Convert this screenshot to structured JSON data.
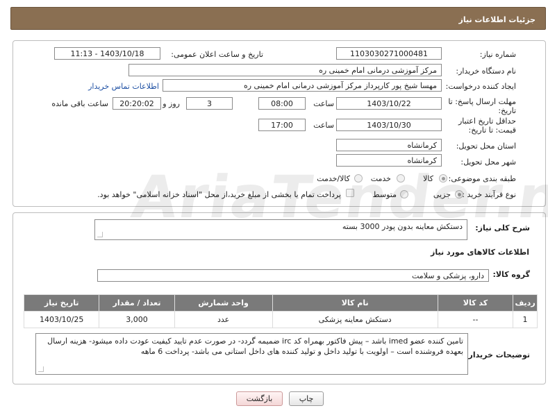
{
  "header": {
    "title": "جزئیات اطلاعات نیاز"
  },
  "form": {
    "need_number_label": "شماره نیاز:",
    "need_number": "1103030271000481",
    "announce_label": "تاریخ و ساعت اعلان عمومی:",
    "announce_value": "1403/10/18 - 11:13",
    "buyer_org_label": "نام دستگاه خریدار:",
    "buyer_org": "مرکز آموزشی درمانی امام خمینی ره",
    "creator_label": "ایجاد کننده درخواست:",
    "creator": "مهسا شیخ پور کارپرداز مرکز آموزشی درمانی امام خمینی ره",
    "contact_link": "اطلاعات تماس خریدار",
    "reply_deadline_label": "مهلت ارسال پاسخ: تا تاریخ:",
    "reply_date": "1403/10/22",
    "time_label": "ساعت",
    "reply_time": "08:00",
    "days": "3",
    "days_label": "روز و",
    "remaining_time": "20:20:02",
    "remaining_label": "ساعت باقی مانده",
    "price_validity_label": "حداقل تاریخ اعتبار قیمت: تا تاریخ:",
    "validity_date": "1403/10/30",
    "validity_time_label": "ساعت",
    "validity_time": "17:00",
    "province_label": "استان محل تحویل:",
    "province": "کرمانشاه",
    "city_label": "شهر محل تحویل:",
    "city": "کرمانشاه",
    "category_label": "طبقه بندی موضوعی:",
    "category_options": [
      "کالا",
      "خدمت",
      "کالا/خدمت"
    ],
    "category_selected": "کالا",
    "process_label": "نوع فرآیند خرید :",
    "process_options": [
      "جزیی",
      "متوسط"
    ],
    "process_selected": "جزیی",
    "payment_note": "پرداخت تمام یا بخشی از مبلغ خرید،از محل \"اسناد خزانه اسلامی\" خواهد بود."
  },
  "details": {
    "description_label": "شرح کلی نیاز:",
    "description": "دستکش معاینه بدون پودر 3000 بسته",
    "goods_info_title": "اطلاعات کالاهای مورد نیاز",
    "goods_group_label": "گروه کالا:",
    "goods_group": "دارو، پزشکی و سلامت",
    "table_headers": [
      "ردیف",
      "کد کالا",
      "نام کالا",
      "واحد شمارش",
      "تعداد / مقدار",
      "تاریخ نیاز"
    ],
    "table_rows": [
      [
        "1",
        "--",
        "دستکش معاینه پزشکی",
        "عدد",
        "3,000",
        "1403/10/25"
      ]
    ],
    "buyer_notes_label": "توضیحات خریدار:",
    "buyer_notes": "تامین کننده عضو imed باشد – پیش فاکتور بهمراه کد irc ضمیمه گردد- در صورت عدم تایید کیفیت عودت داده میشود- هزینه ارسال بعهده فروشنده است – اولویت با تولید داخل و تولید کننده های داخل استانی می باشد- پرداخت 6 ماهه"
  },
  "buttons": {
    "print": "چاپ",
    "back": "بازگشت"
  },
  "watermark_text": "AriaTender.neT"
}
